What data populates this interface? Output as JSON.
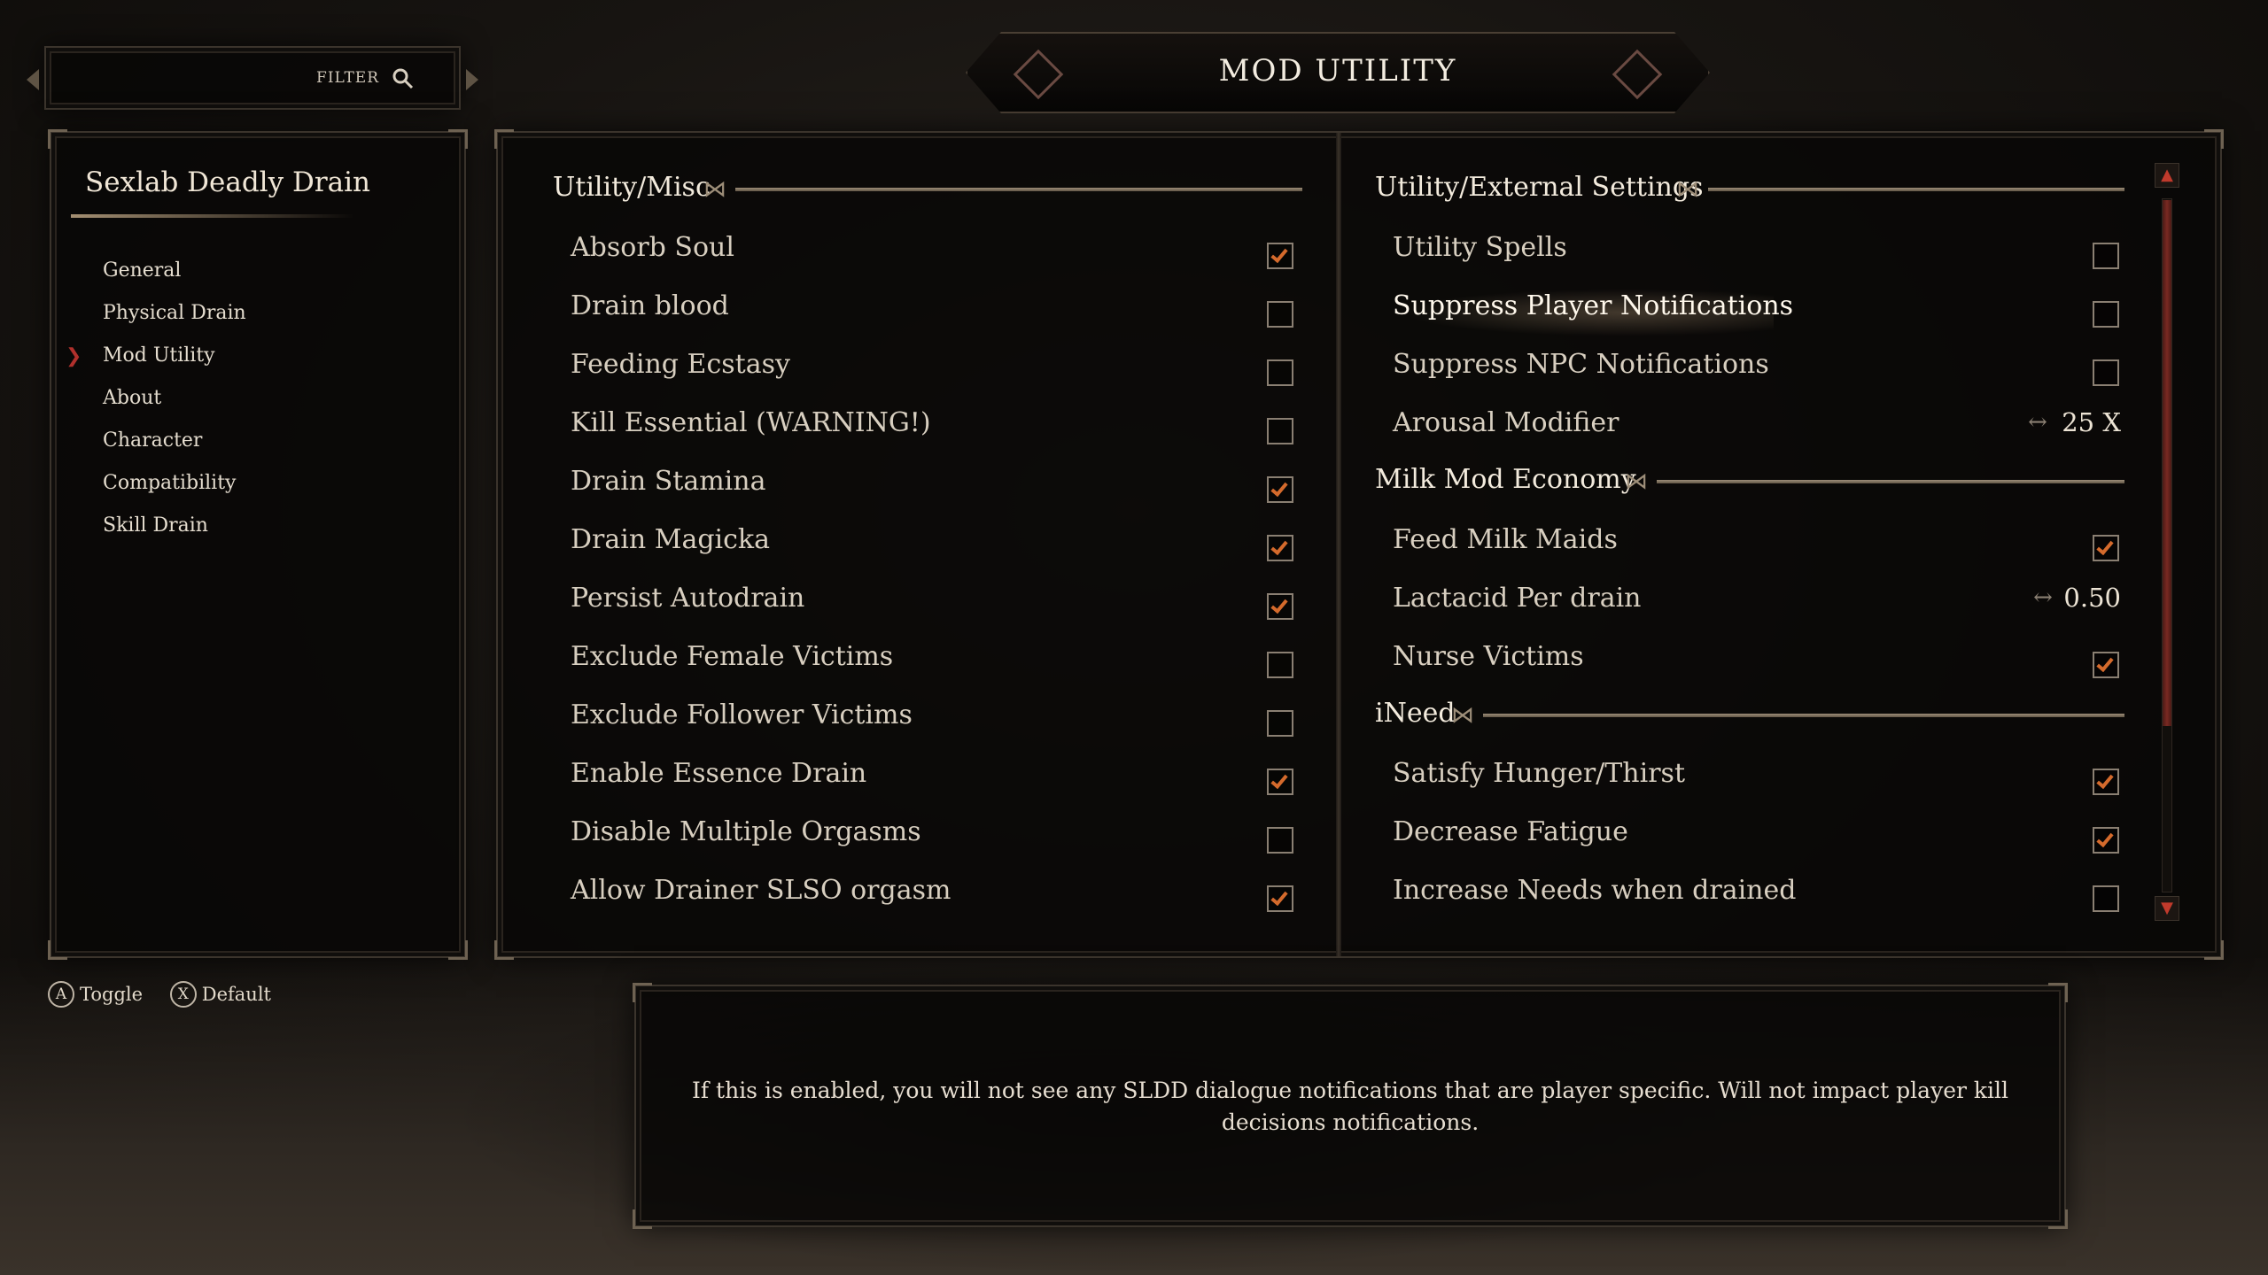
{
  "filter": {
    "label": "FILTER",
    "icon": "search-icon"
  },
  "title": "MOD UTILITY",
  "nav": {
    "mod_name": "Sexlab Deadly Drain",
    "items": [
      {
        "label": "General"
      },
      {
        "label": "Physical Drain"
      },
      {
        "label": "Mod Utility",
        "selected": true
      },
      {
        "label": "About"
      },
      {
        "label": "Character"
      },
      {
        "label": "Compatibility"
      },
      {
        "label": "Skill Drain"
      }
    ]
  },
  "left_column": {
    "header": "Utility/Misc",
    "options": [
      {
        "label": "Absorb Soul",
        "checked": true
      },
      {
        "label": "Drain blood",
        "checked": false
      },
      {
        "label": "Feeding Ecstasy",
        "checked": false
      },
      {
        "label": "Kill Essential (WARNING!)",
        "checked": false
      },
      {
        "label": "Drain Stamina",
        "checked": true
      },
      {
        "label": "Drain Magicka",
        "checked": true
      },
      {
        "label": "Persist Autodrain",
        "checked": true
      },
      {
        "label": "Exclude Female Victims",
        "checked": false
      },
      {
        "label": "Exclude Follower Victims",
        "checked": false
      },
      {
        "label": "Enable Essence Drain",
        "checked": true
      },
      {
        "label": "Disable Multiple Orgasms",
        "checked": false
      },
      {
        "label": "Allow Drainer SLSO orgasm",
        "checked": true
      }
    ]
  },
  "right_column": {
    "header_utility": "Utility/External Settings",
    "utility_spells": "Utility Spells",
    "suppress_player": "Suppress Player Notifications",
    "suppress_npc": "Suppress NPC Notifications",
    "arousal_modifier": "Arousal Modifier",
    "arousal_value": "25 X",
    "header_milk": "Milk Mod Economy",
    "feed_milk": "Feed Milk Maids",
    "lactacid": "Lactacid Per drain",
    "lactacid_value": "0.50",
    "nurse": "Nurse Victims",
    "header_ineed": "iNeed",
    "satisfy": "Satisfy Hunger/Thirst",
    "decrease_fatigue": "Decrease Fatigue",
    "increase_needs": "Increase Needs when drained"
  },
  "hints": {
    "toggle_key": "A",
    "toggle_label": "Toggle",
    "default_key": "X",
    "default_label": "Default"
  },
  "description": "If this is enabled, you will not see any SLDD dialogue notifications that are player specific. Will not impact player kill decisions notifications.",
  "colors": {
    "accent_check": "#d46a2c",
    "selection_marker": "#b0302c",
    "scroll_thumb": "#7a2a22"
  }
}
